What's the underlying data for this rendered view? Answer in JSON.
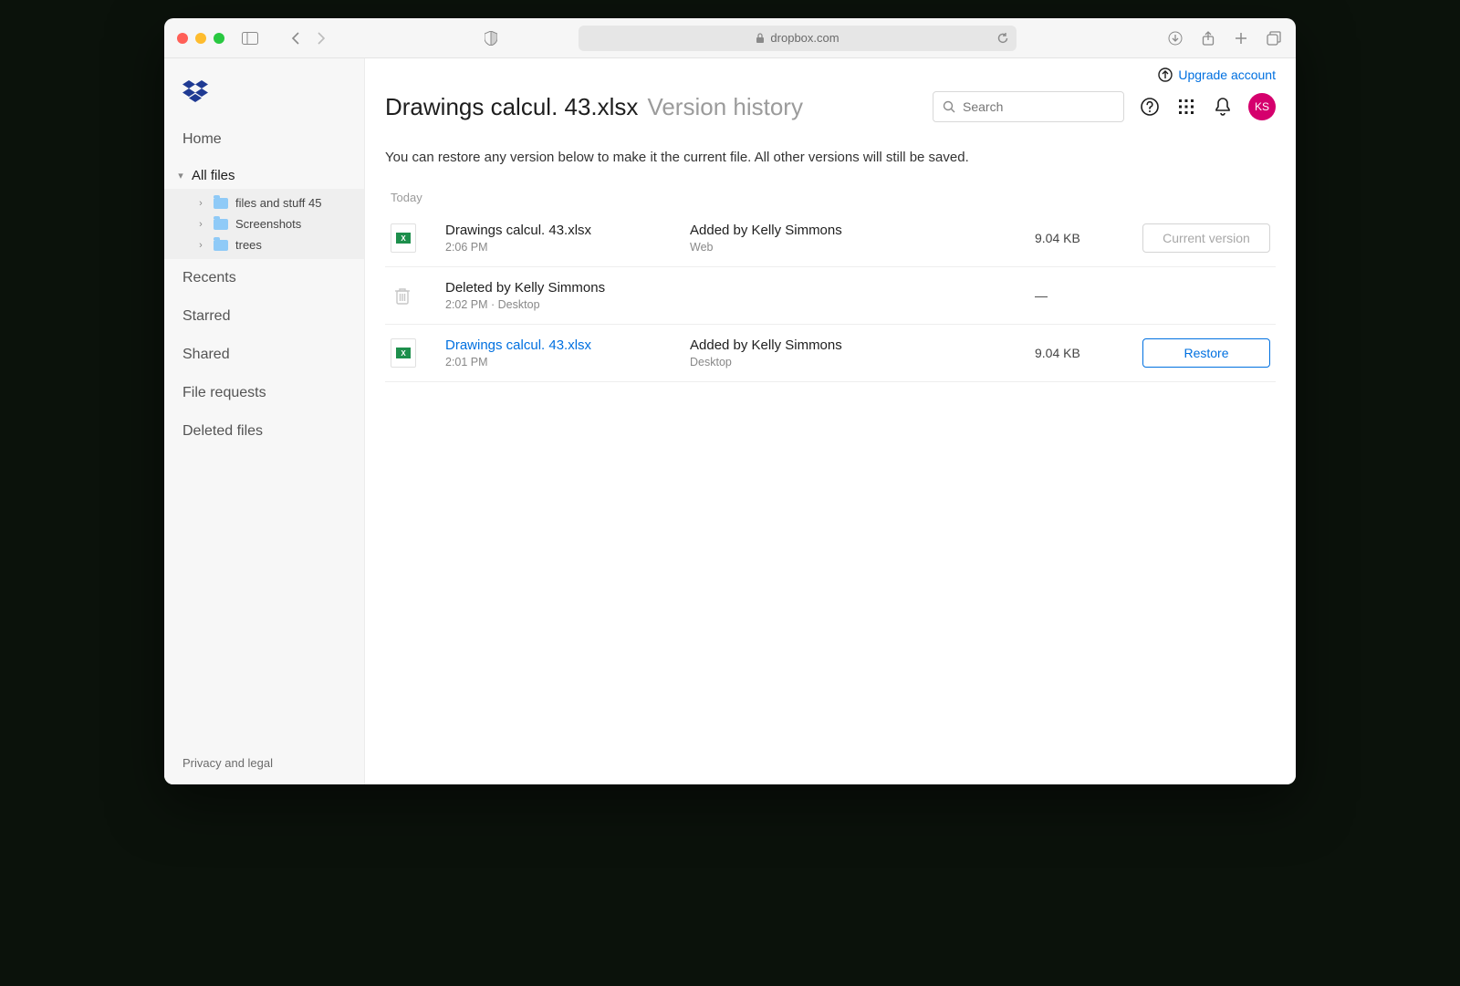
{
  "chrome": {
    "url": "dropbox.com"
  },
  "upgrade": {
    "label": "Upgrade account"
  },
  "sidebar": {
    "home": "Home",
    "all_files": "All files",
    "tree": [
      {
        "label": "files and stuff 45"
      },
      {
        "label": "Screenshots"
      },
      {
        "label": "trees"
      }
    ],
    "recents": "Recents",
    "starred": "Starred",
    "shared": "Shared",
    "file_requests": "File requests",
    "deleted_files": "Deleted files",
    "footer": "Privacy and legal"
  },
  "header": {
    "filename": "Drawings calcul. 43.xlsx",
    "subtitle": "Version history",
    "search_placeholder": "Search",
    "avatar": "KS"
  },
  "main": {
    "description": "You can restore any version below to make it the current file. All other versions will still be saved.",
    "group": "Today",
    "versions": [
      {
        "kind": "file",
        "name": "Drawings calcul. 43.xlsx",
        "time": "2:06 PM",
        "action": "Added by Kelly Simmons",
        "source": "Web",
        "size": "9.04 KB",
        "button": "Current version",
        "button_style": "disabled",
        "name_style": "plain"
      },
      {
        "kind": "deleted",
        "name": "Deleted by Kelly Simmons",
        "time": "2:02 PM · Desktop",
        "action": "",
        "source": "",
        "size": "—",
        "button": "",
        "button_style": "none",
        "name_style": "plain"
      },
      {
        "kind": "file",
        "name": "Drawings calcul. 43.xlsx",
        "time": "2:01 PM",
        "action": "Added by Kelly Simmons",
        "source": "Desktop",
        "size": "9.04 KB",
        "button": "Restore",
        "button_style": "primary",
        "name_style": "link"
      }
    ]
  }
}
